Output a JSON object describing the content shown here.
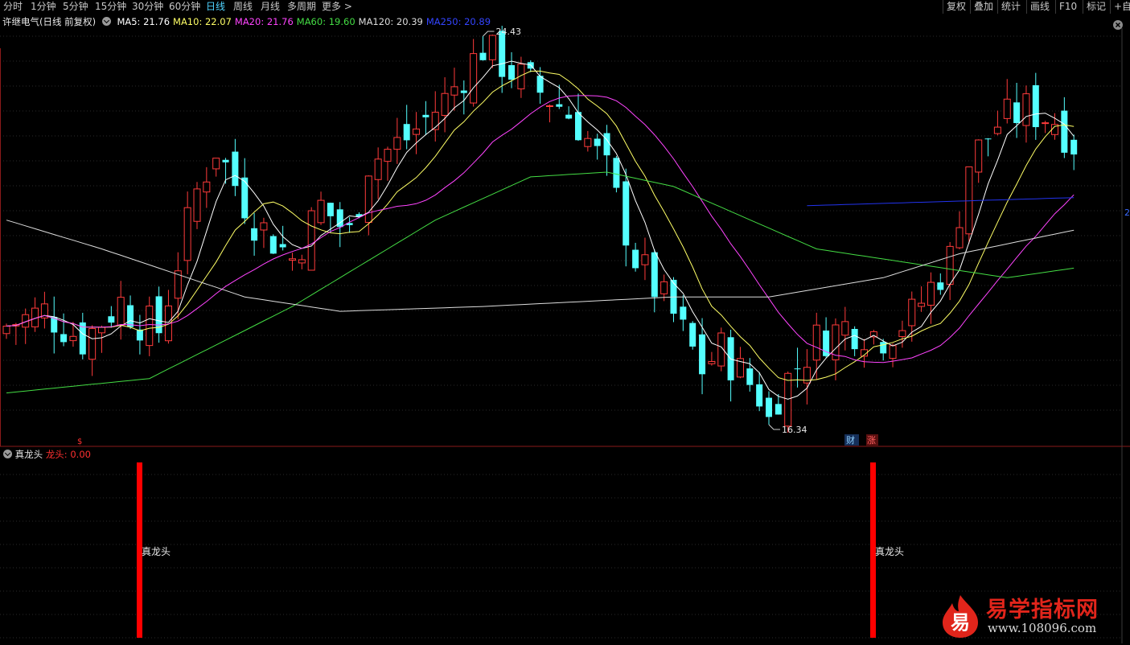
{
  "toolbar": {
    "periods": [
      "分时",
      "1分钟",
      "5分钟",
      "15分钟",
      "30分钟",
      "60分钟",
      "日线",
      "周线",
      "月线",
      "多周期",
      "更多 >"
    ],
    "active_period": "日线",
    "right_buttons": [
      "复权",
      "叠加",
      "统计",
      "画线",
      "F10",
      "标记",
      "+自选"
    ]
  },
  "main_info": {
    "stock_title": "许继电气(日线 前复权)",
    "ma": [
      {
        "label": "MA5: 21.76",
        "color": "#ffffff"
      },
      {
        "label": "MA10: 22.07",
        "color": "#ffff66"
      },
      {
        "label": "MA20: 21.76",
        "color": "#ff44ff"
      },
      {
        "label": "MA60: 19.60",
        "color": "#44dd44"
      },
      {
        "label": "MA120: 20.39",
        "color": "#dddddd"
      },
      {
        "label": "MA250: 20.89",
        "color": "#3344ff"
      }
    ]
  },
  "price_marks": {
    "high": "24.43",
    "low": "16.34"
  },
  "event_marks": {
    "s_mark": "$",
    "cai": "财",
    "zhang": "涨"
  },
  "right_edge_label": "2",
  "sub_indicator": {
    "name": "真龙头",
    "param_label": "龙头: 0.00",
    "bar_caption": "真龙头"
  },
  "logo": {
    "text": "易学指标网",
    "url": "www.108096.com",
    "glyph": "易"
  },
  "colors": {
    "up": "#ff3b3b",
    "down": "#54ffff",
    "bg": "#000000",
    "signal_bar": "#ff0000"
  }
}
